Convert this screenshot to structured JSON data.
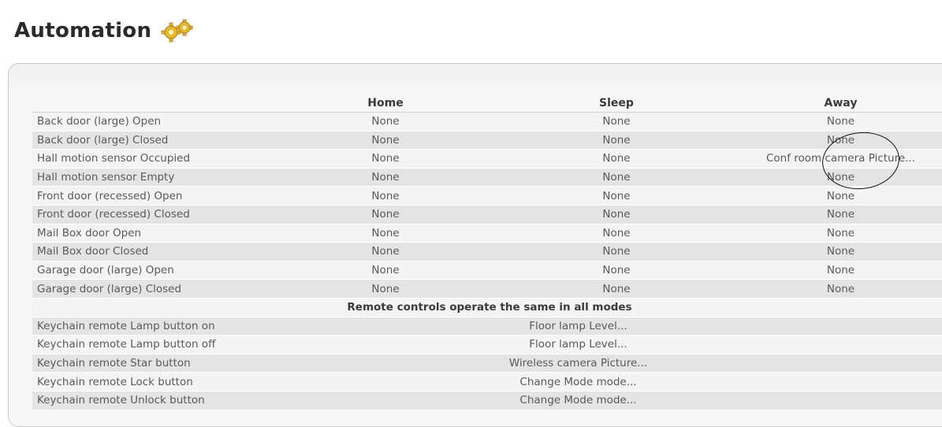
{
  "header": {
    "title": "Automation",
    "icon": "gears-icon"
  },
  "table": {
    "columns": [
      "",
      "Home",
      "Sleep",
      "Away"
    ],
    "rows": [
      {
        "label": "Back door (large) Open",
        "home": "None",
        "sleep": "None",
        "away": "None"
      },
      {
        "label": "Back door (large) Closed",
        "home": "None",
        "sleep": "None",
        "away": "None"
      },
      {
        "label": "Hall motion sensor Occupied",
        "home": "None",
        "sleep": "None",
        "away": "Conf room camera Picture..."
      },
      {
        "label": "Hall motion sensor Empty",
        "home": "None",
        "sleep": "None",
        "away": "None"
      },
      {
        "label": "Front door (recessed) Open",
        "home": "None",
        "sleep": "None",
        "away": "None"
      },
      {
        "label": "Front door (recessed) Closed",
        "home": "None",
        "sleep": "None",
        "away": "None"
      },
      {
        "label": "Mail Box door Open",
        "home": "None",
        "sleep": "None",
        "away": "None"
      },
      {
        "label": "Mail Box door Closed",
        "home": "None",
        "sleep": "None",
        "away": "None"
      },
      {
        "label": "Garage door (large) Open",
        "home": "None",
        "sleep": "None",
        "away": "None"
      },
      {
        "label": "Garage door (large) Closed",
        "home": "None",
        "sleep": "None",
        "away": "None"
      }
    ],
    "remote_header": "Remote controls operate the same in all modes",
    "remote_rows": [
      {
        "label": "Keychain remote Lamp button on",
        "action": "Floor lamp Level..."
      },
      {
        "label": "Keychain remote Lamp button off",
        "action": "Floor lamp Level..."
      },
      {
        "label": "Keychain remote Star button",
        "action": "Wireless camera Picture..."
      },
      {
        "label": "Keychain remote Lock button",
        "action": "Change Mode mode..."
      },
      {
        "label": "Keychain remote Unlock button",
        "action": "Change Mode mode..."
      }
    ]
  },
  "colors": {
    "row_light": "#f4f4f4",
    "row_dark": "#e4e4e4",
    "gear": "#e8b72a"
  }
}
